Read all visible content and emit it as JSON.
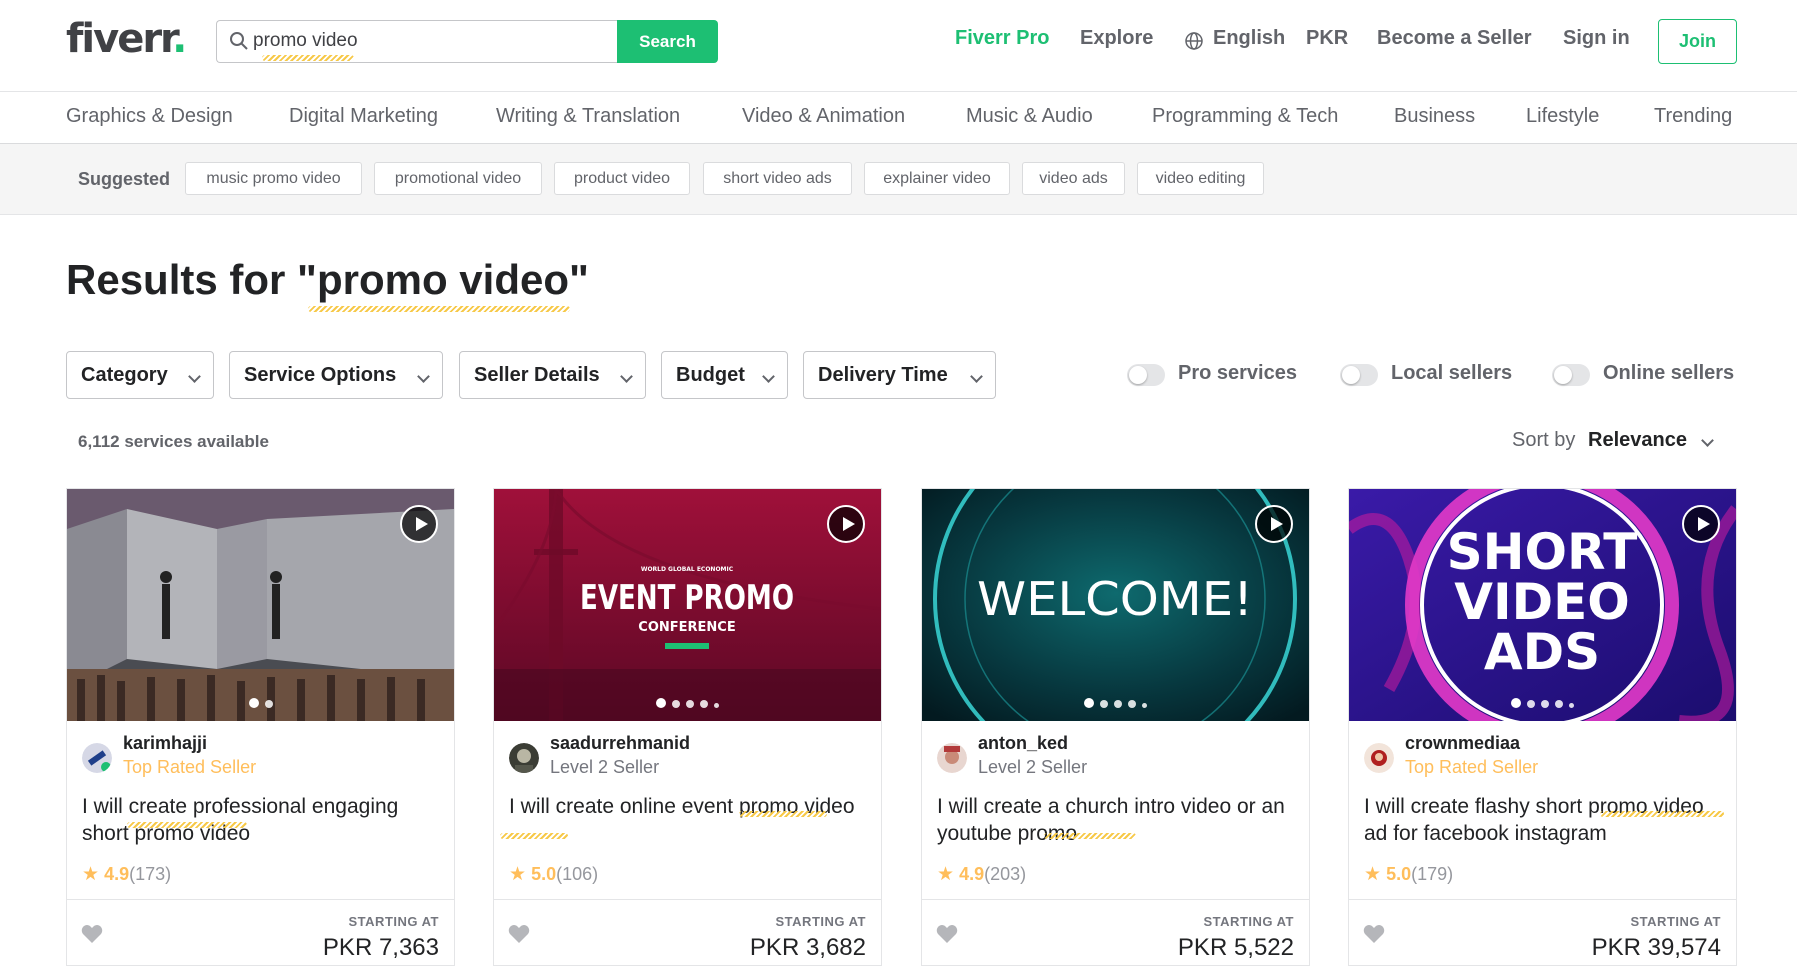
{
  "header": {
    "logo": "fiverr",
    "logo_dot": ".",
    "search": {
      "value": "promo video",
      "button": "Search"
    },
    "nav": {
      "pro": "Fiverr Pro",
      "explore": "Explore",
      "language": "English",
      "currency": "PKR",
      "become_seller": "Become a Seller",
      "sign_in": "Sign in",
      "join": "Join"
    }
  },
  "categories": [
    "Graphics & Design",
    "Digital Marketing",
    "Writing & Translation",
    "Video & Animation",
    "Music & Audio",
    "Programming & Tech",
    "Business",
    "Lifestyle",
    "Trending"
  ],
  "suggested": {
    "label": "Suggested",
    "chips": [
      "music promo video",
      "promotional video",
      "product video",
      "short video ads",
      "explainer video",
      "video ads",
      "video editing"
    ]
  },
  "results": {
    "prefix": "Results for \"",
    "query": "promo video",
    "suffix": "\"",
    "count": "6,112 services available",
    "sort_label": "Sort by",
    "sort_value": "Relevance"
  },
  "filters": [
    "Category",
    "Service Options",
    "Seller Details",
    "Budget",
    "Delivery Time"
  ],
  "toggles": [
    "Pro services",
    "Local sellers",
    "Online sellers"
  ],
  "gigs": [
    {
      "seller": "karimhajji",
      "level": "Top Rated Seller",
      "title": "I will create professional engaging short promo video",
      "rating": "4.9",
      "reviews": "(173)",
      "starting_label": "STARTING AT",
      "price": "PKR 7,363",
      "thumb_text": ""
    },
    {
      "seller": "saadurrehmanid",
      "level": "Level 2 Seller",
      "title": "I will create online event promo video",
      "rating": "5.0",
      "reviews": "(106)",
      "starting_label": "STARTING AT",
      "price": "PKR 3,682",
      "thumb_text": "EVENT PROMO",
      "thumb_sub": "CONFERENCE",
      "thumb_top": "WORLD GLOBAL ECONOMIC"
    },
    {
      "seller": "anton_ked",
      "level": "Level 2 Seller",
      "title": "I will create a church intro video or an youtube promo",
      "rating": "4.9",
      "reviews": "(203)",
      "starting_label": "STARTING AT",
      "price": "PKR 5,522",
      "thumb_text": "WELCOME!"
    },
    {
      "seller": "crownmediaa",
      "level": "Top Rated Seller",
      "title": "I will create flashy short promo video ad for facebook instagram",
      "rating": "5.0",
      "reviews": "(179)",
      "starting_label": "STARTING AT",
      "price": "PKR 39,574",
      "thumb_lines": [
        "SHORT",
        "VIDEO",
        "ADS"
      ]
    }
  ],
  "colors": {
    "brand_green": "#1dbf73",
    "top_rated": "#ffbe5b",
    "text_dark": "#222325",
    "text_muted": "#62646a"
  },
  "icons": [
    "search-icon",
    "globe-icon",
    "chevron-down-icon",
    "play-icon",
    "star-icon",
    "heart-icon"
  ]
}
